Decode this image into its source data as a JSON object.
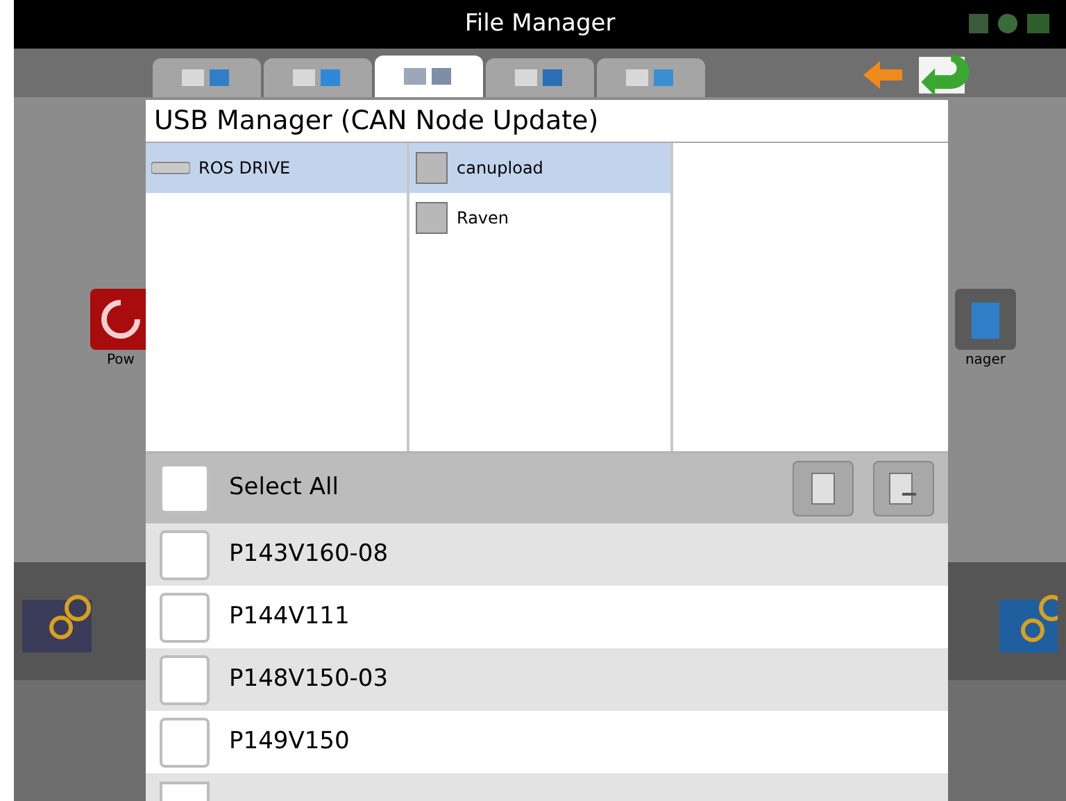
{
  "window": {
    "title": "File Manager"
  },
  "tabs": [
    {
      "selected": false
    },
    {
      "selected": false
    },
    {
      "selected": true
    },
    {
      "selected": false
    },
    {
      "selected": false
    }
  ],
  "background": {
    "left_label": "Pow",
    "right_label": "nager"
  },
  "dialog": {
    "title": "USB Manager (CAN Node Update)",
    "columns": [
      [
        {
          "kind": "drive",
          "label": "ROS DRIVE",
          "selected": true
        }
      ],
      [
        {
          "kind": "folder",
          "label": "canupload",
          "selected": true
        },
        {
          "kind": "folder",
          "label": "Raven",
          "selected": false
        }
      ],
      []
    ],
    "select_all": {
      "label": "Select All",
      "checked": false
    },
    "files": [
      {
        "name": "P143V160-08",
        "checked": false
      },
      {
        "name": "P144V111",
        "checked": false
      },
      {
        "name": "P148V150-03",
        "checked": false
      },
      {
        "name": "P149V150",
        "checked": false
      }
    ],
    "partial_row": {
      "checked": false
    }
  }
}
